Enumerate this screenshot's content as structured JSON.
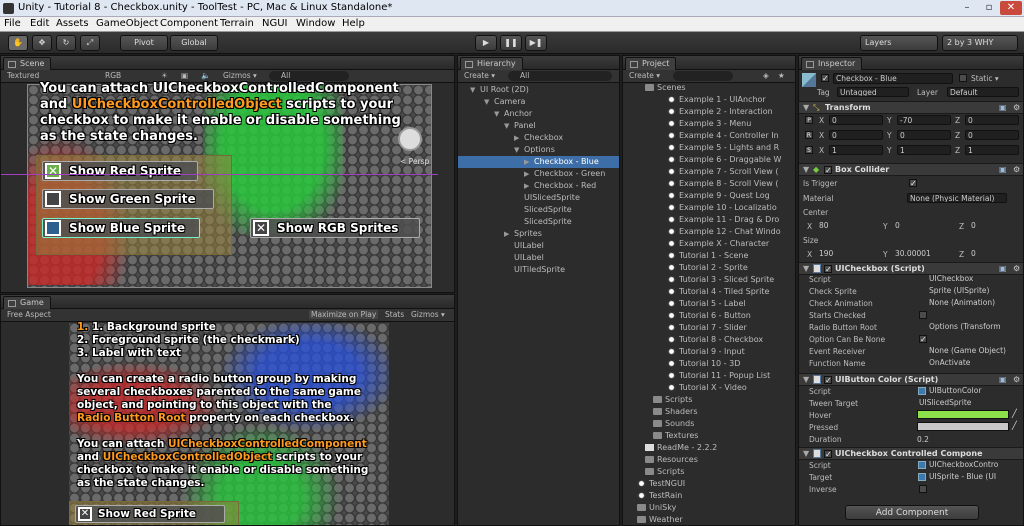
{
  "title": "Unity - Tutorial 8 - Checkbox.unity - ToolTest - PC, Mac & Linux Standalone*",
  "window_controls": [
    "–",
    "▫",
    "✕"
  ],
  "menu": [
    "File",
    "Edit",
    "Assets",
    "GameObject",
    "Component",
    "Terrain",
    "NGUI",
    "Window",
    "Help"
  ],
  "toolbar": {
    "pivot": "Pivot",
    "global": "Global",
    "layers": "Layers",
    "layout": "2 by 3 WHY"
  },
  "scene": {
    "tab": "Scene",
    "textured": "Textured",
    "rgb": "RGB",
    "gizmos": "Gizmos ▾",
    "search": "All",
    "text_top": "You can attach UICheckboxControlledComponent",
    "text_line2a": "and ",
    "text_line2b": "UICheckboxControlledObject",
    "text_line2c": " scripts to your",
    "text_line3": "checkbox to make it enable or disable something",
    "text_line4": "as the state changes.",
    "persp": "< Persp",
    "btn_red": "Show Red Sprite",
    "btn_green": "Show Green Sprite",
    "btn_blue": "Show Blue Sprite",
    "btn_rgb": "Show RGB Sprites"
  },
  "game": {
    "tab": "Game",
    "aspect": "Free Aspect",
    "maximize": "Maximize on Play",
    "stats": "Stats",
    "gizmos": "Gizmos ▾",
    "list": [
      "1. Background sprite",
      "2. Foreground sprite (the checkmark)",
      "3. Label with text"
    ],
    "p1": [
      "You can create a radio button group by making",
      "several checkboxes parented to the same game",
      "object, and pointing to this object with the"
    ],
    "p1_last_a": "Radio Button Root",
    "p1_last_b": " property on each checkbox.",
    "p2_l1a": "You can attach ",
    "p2_l1b": "UICheckboxControlledComponent",
    "p2_l2a": "and ",
    "p2_l2b": "UICheckboxControlledObject",
    "p2_l2c": " scripts to your",
    "p2_l3": "checkbox to make it enable or disable something",
    "p2_l4": "as the state changes.",
    "btn_red": "Show Red Sprite"
  },
  "hierarchy": {
    "tab": "Hierarchy",
    "create": "Create ▾",
    "search": "All",
    "items": [
      {
        "label": "UI Root (2D)",
        "arrow": "▼"
      },
      {
        "label": "Camera",
        "arrow": "▼"
      },
      {
        "label": "Anchor",
        "arrow": "▼"
      },
      {
        "label": "Panel",
        "arrow": "▼"
      },
      {
        "label": "Checkbox",
        "arrow": "▶"
      },
      {
        "label": "Options",
        "arrow": "▼"
      },
      {
        "label": "Checkbox - Blue",
        "arrow": "▶"
      },
      {
        "label": "Checkbox - Green",
        "arrow": "▶"
      },
      {
        "label": "Checkbox - Red",
        "arrow": "▶"
      },
      {
        "label": "UISlicedSprite",
        "arrow": ""
      },
      {
        "label": "SlicedSprite",
        "arrow": ""
      },
      {
        "label": "SlicedSprite",
        "arrow": ""
      },
      {
        "label": "Sprites",
        "arrow": "▶"
      },
      {
        "label": "UILabel",
        "arrow": ""
      },
      {
        "label": "UILabel",
        "arrow": ""
      },
      {
        "label": "UITiledSprite",
        "arrow": ""
      }
    ]
  },
  "project": {
    "tab": "Project",
    "create": "Create ▾",
    "scenes_folder": "Scenes",
    "scenes": [
      "Example 1 - UIAnchor",
      "Example 2 - Interaction",
      "Example 3 - Menu",
      "Example 4 - Controller In",
      "Example 5 - Lights and R",
      "Example 6 - Draggable W",
      "Example 7 - Scroll View (",
      "Example 8 - Scroll View (",
      "Example 9 - Quest Log",
      "Example 10 - Localizatio",
      "Example 11 - Drag & Dro",
      "Example 12 - Chat Windo",
      "Example X - Character",
      "Tutorial 1 - Scene",
      "Tutorial 2 - Sprite",
      "Tutorial 3 - Sliced Sprite",
      "Tutorial 4 - Tiled Sprite",
      "Tutorial 5 - Label",
      "Tutorial 6 - Button",
      "Tutorial 7 - Slider",
      "Tutorial 8 - Checkbox",
      "Tutorial 9 - Input",
      "Tutorial 10 - 3D",
      "Tutorial 11 - Popup List",
      "Tutorial X - Video"
    ],
    "folders_a": [
      "Scripts",
      "Shaders",
      "Sounds",
      "Textures"
    ],
    "readme": "ReadMe - 2.2.2",
    "folders_b": [
      "Resources",
      "Scripts"
    ],
    "tail": [
      "TestNGUI",
      "TestRain",
      "UniSky",
      "Weather"
    ]
  },
  "inspector": {
    "tab": "Inspector",
    "object_name": "Checkbox - Blue",
    "static": "Static ▾",
    "tag_label": "Tag",
    "tag": "Untagged",
    "layer_label": "Layer",
    "layer": "Default",
    "transform": {
      "header": "Transform",
      "pos": [
        "0",
        "-70",
        "0"
      ],
      "rot": [
        "0",
        "0",
        "0"
      ],
      "scale": [
        "1",
        "1",
        "1"
      ],
      "p": "P",
      "r": "R",
      "s": "S"
    },
    "box": {
      "header": "Box Collider",
      "is_trigger": "Is Trigger",
      "material": "Material",
      "material_val": "None (Physic Material)",
      "center": "Center",
      "center_val": [
        "80",
        "0",
        "0"
      ],
      "size": "Size",
      "size_val": [
        "190",
        "30.00001",
        "0"
      ]
    },
    "uicheckbox": {
      "header": "UICheckbox (Script)",
      "rows": [
        {
          "label": "Script",
          "value": "UICheckbox"
        },
        {
          "label": "Check Sprite",
          "value": "Sprite (UISprite)"
        },
        {
          "label": "Check Animation",
          "value": "None (Animation)"
        },
        {
          "label": "Starts Checked",
          "value": ""
        },
        {
          "label": "Radio Button Root",
          "value": "Options (Transform"
        },
        {
          "label": "Option Can Be None",
          "value": ""
        },
        {
          "label": "Event Receiver",
          "value": "None (Game Object)"
        },
        {
          "label": "Function Name",
          "value": "OnActivate"
        }
      ]
    },
    "uibuttoncolor": {
      "header": "UIButton Color (Script)",
      "script_label": "Script",
      "script": "UIButtonColor",
      "target_label": "Tween Target",
      "target": "UISlicedSprite",
      "hover": "Hover",
      "pressed": "Pressed",
      "duration": "Duration",
      "duration_val": "0.2",
      "hover_color": "#8ce04a",
      "pressed_color": "#c8c8c8"
    },
    "controlled": {
      "header": "UICheckbox Controlled Compone",
      "script_label": "Script",
      "script": "UICheckboxContro",
      "target_label": "Target",
      "target": "UISprite - Blue (UI",
      "inverse": "Inverse"
    },
    "add_component": "Add Component"
  }
}
